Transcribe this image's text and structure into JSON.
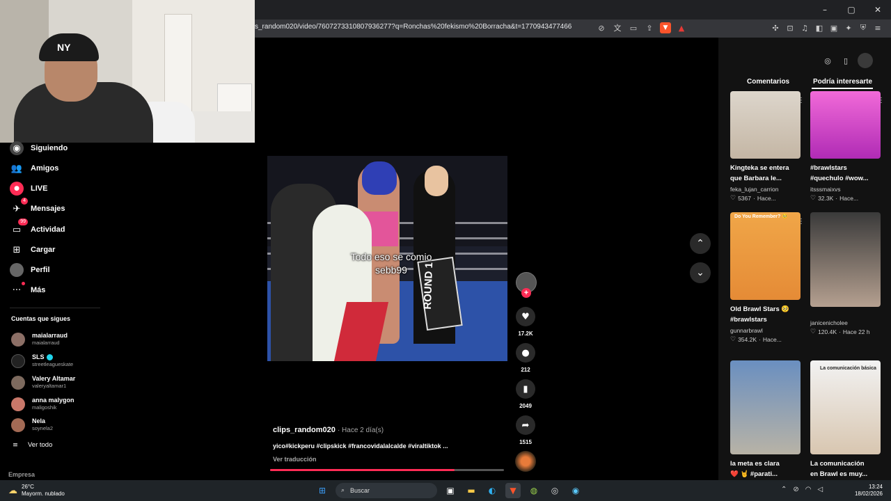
{
  "browser": {
    "url": "s_random020/video/7607273310807936277?q=Ronchas%20fekismo%20Borracha&t=1770943477466",
    "window_controls": [
      "–",
      "▢",
      "✕"
    ],
    "address_icons": [
      "no-sync-icon",
      "translate-icon",
      "picture-icon",
      "share-icon",
      "brave-shield-icon",
      "brave-rewards-icon"
    ],
    "extension_icons": [
      "puzzle-icon",
      "screenshot-icon",
      "music-icon",
      "sidebar-icon",
      "wallet-icon",
      "leo-icon",
      "vpn-icon",
      "menu-icon"
    ]
  },
  "nav": {
    "items": [
      {
        "label": "Siguiendo",
        "icon": "following-icon"
      },
      {
        "label": "Amigos",
        "icon": "friends-icon"
      },
      {
        "label": "LIVE",
        "icon": "live-icon"
      },
      {
        "label": "Mensajes",
        "icon": "messages-icon",
        "badge": "4"
      },
      {
        "label": "Actividad",
        "icon": "activity-icon",
        "badge": "99"
      },
      {
        "label": "Cargar",
        "icon": "upload-icon"
      },
      {
        "label": "Perfil",
        "icon": "profile-icon"
      },
      {
        "label": "Más",
        "icon": "more-icon"
      }
    ],
    "following_title": "Cuentas que sigues",
    "accounts": [
      {
        "name": "maialarraud",
        "handle": "maialarraud"
      },
      {
        "name": "SLS",
        "handle": "streetleagueskate",
        "verified": true
      },
      {
        "name": "Valery Altamar",
        "handle": "valeryaltamar1"
      },
      {
        "name": "anna malygon",
        "handle": "maligoshik"
      },
      {
        "name": "Nela",
        "handle": "soynela2"
      }
    ],
    "see_all": "Ver todo",
    "footer": "Empresa"
  },
  "video": {
    "caption_line1": "Todo eso se comio",
    "caption_line2": "sebb99",
    "round_card": "ROUND 1",
    "author": "clips_random020",
    "posted": "· Hace 2 día(s)",
    "description": "yico#kickperu #clipskick #francovidalalcalde #viraltiktok ...",
    "translate": "Ver traducción",
    "progress": 0.79
  },
  "actions": {
    "likes": "17.2K",
    "comments": "212",
    "saves": "2049",
    "shares": "1515"
  },
  "panel": {
    "tabs": [
      "Comentarios",
      "Podría interesarte"
    ],
    "active_tab": "Podría interesarte",
    "cards": [
      {
        "title1": "Kingteka se entera",
        "title2": "que Barbara le...",
        "user": "feka_lujan_carrion",
        "likes": "5367",
        "age": "Hace..."
      },
      {
        "title1": "#brawlstars",
        "title2": "#quechulo #wow...",
        "user": "itsssmaixvs",
        "likes": "32.3K",
        "age": "Hace..."
      },
      {
        "title1": "Old Brawl Stars 🥺",
        "title2": "#brawlstars",
        "user": "gunnarbrawl",
        "likes": "354.2K",
        "age": "Hace...",
        "thumb_text": "Do You Remember? 🥺"
      },
      {
        "title1": "janicenicholee",
        "title2": "",
        "user": "",
        "likes": "120.4K",
        "age": "Hace 22 h"
      },
      {
        "title1": "la meta es clara",
        "title2": "❤️ 🤘 #parati...",
        "user": "",
        "likes": "",
        "age": ""
      },
      {
        "title1": "La comunicación",
        "title2": "en Brawl es muy...",
        "user": "",
        "likes": "",
        "age": "",
        "thumb_text": "La comunicación básica"
      }
    ]
  },
  "taskbar": {
    "temp": "26°C",
    "weather": "Mayorm. nublado",
    "search": "Buscar",
    "time": "13:24",
    "date": "18/02/2026"
  },
  "colors": {
    "accent": "#fe2c55",
    "panel": "#121212",
    "verified": "#20d5ec"
  }
}
